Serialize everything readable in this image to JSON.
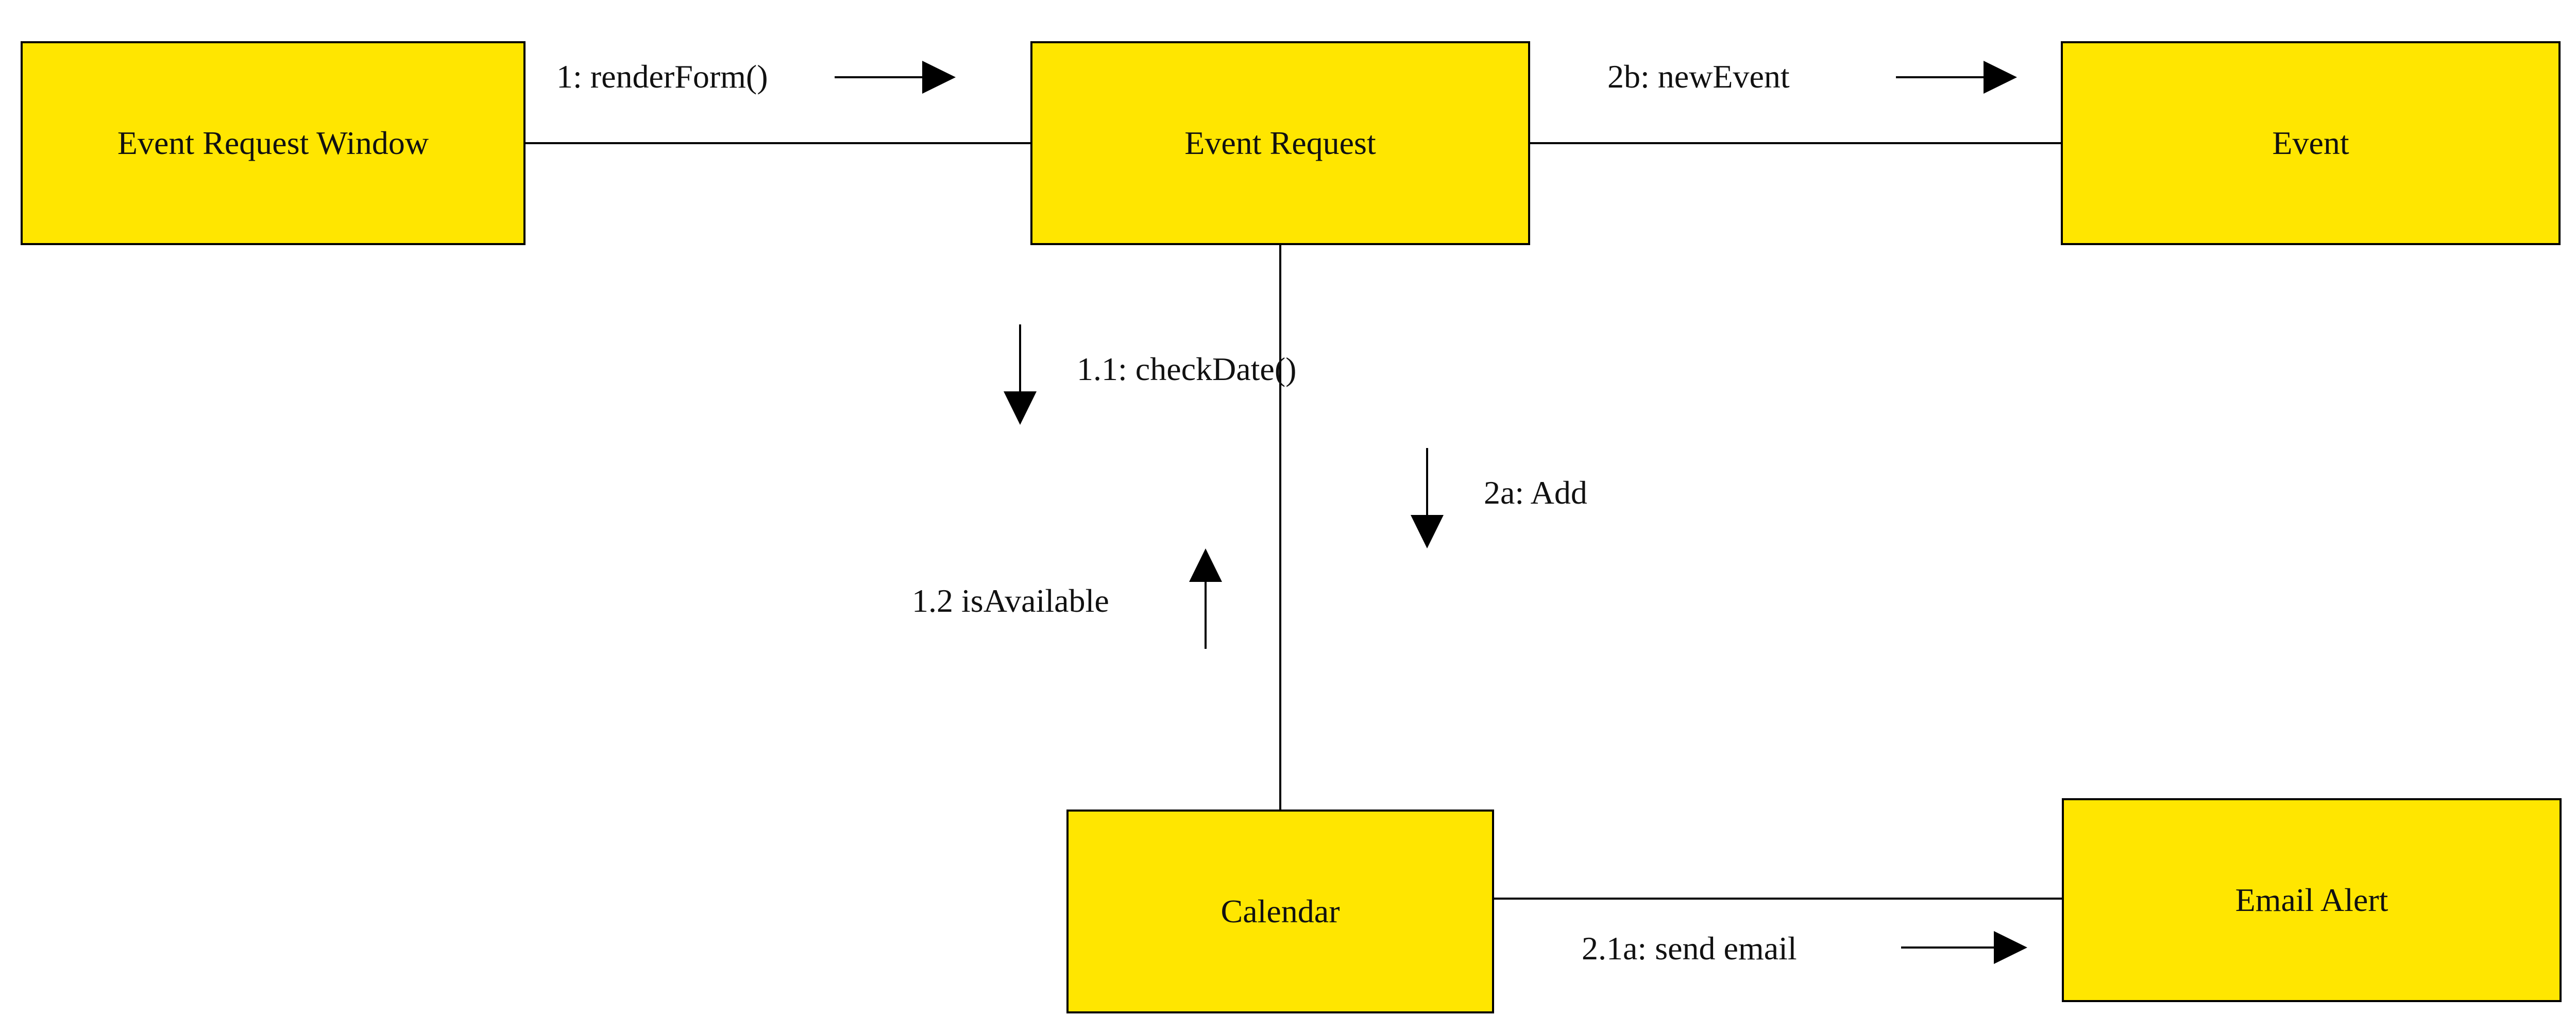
{
  "colors": {
    "node_fill": "#ffe600",
    "stroke": "#000000",
    "text": "#111111",
    "background": "#ffffff"
  },
  "nodes": {
    "event_request_window": {
      "label": "Event Request Window"
    },
    "event_request": {
      "label": "Event Request"
    },
    "event": {
      "label": "Event"
    },
    "calendar": {
      "label": "Calendar"
    },
    "email_alert": {
      "label": "Email Alert"
    }
  },
  "messages": {
    "m1": {
      "label": "1: renderForm()"
    },
    "m1_1": {
      "label": "1.1: checkDate()"
    },
    "m1_2": {
      "label": "1.2 isAvailable"
    },
    "m2a": {
      "label": "2a: Add"
    },
    "m2b": {
      "label": "2b: newEvent"
    },
    "m2_1a": {
      "label": "2.1a: send email"
    }
  }
}
